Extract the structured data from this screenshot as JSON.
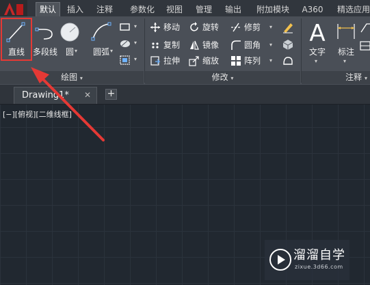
{
  "ribbon": {
    "tabs": [
      {
        "label": "默认",
        "active": true
      },
      {
        "label": "插入"
      },
      {
        "label": "注释"
      },
      {
        "label": "参数化"
      },
      {
        "label": "视图"
      },
      {
        "label": "管理"
      },
      {
        "label": "输出"
      },
      {
        "label": "附加模块"
      },
      {
        "label": "A360"
      },
      {
        "label": "精选应用"
      }
    ],
    "draw_panel": {
      "title": "绘图",
      "tools": [
        "直线",
        "多段线",
        "圆",
        "圆弧"
      ]
    },
    "modify_panel": {
      "title": "修改",
      "rows": [
        [
          "移动",
          "旋转",
          "修剪"
        ],
        [
          "复制",
          "镜像",
          "圆角"
        ],
        [
          "拉伸",
          "缩放",
          "阵列"
        ]
      ]
    },
    "annotation_panel": {
      "title": "注释",
      "tools": [
        "文字",
        "标注"
      ]
    }
  },
  "document": {
    "tab_name": "Drawing1*",
    "close_glyph": "✕",
    "new_tab_glyph": "+"
  },
  "viewport": {
    "label": "[−][俯视][二维线框]"
  },
  "watermark": {
    "main": "溜溜自学",
    "sub": "zixue.3d66.com"
  },
  "colors": {
    "highlight": "#e53935",
    "canvas": "#212830",
    "ribbon": "#4a4f57"
  }
}
